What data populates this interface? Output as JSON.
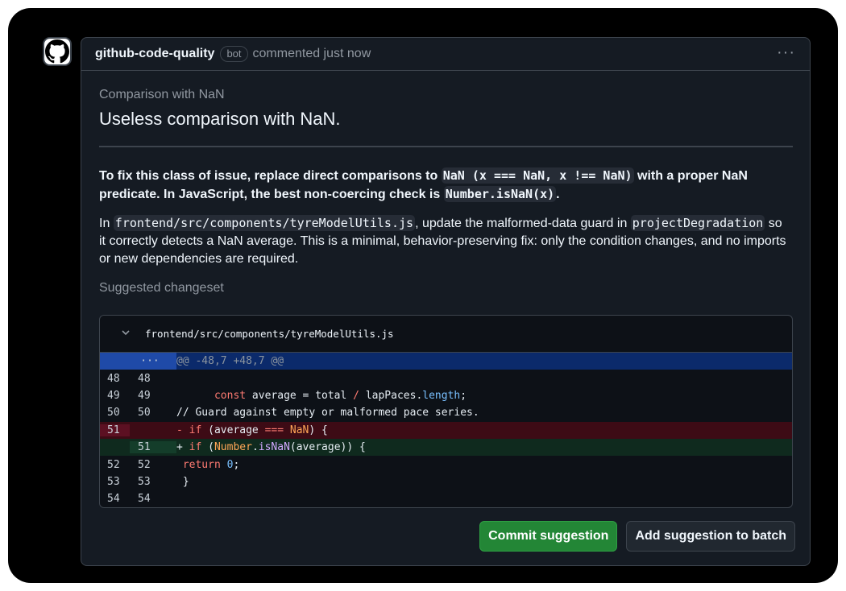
{
  "header": {
    "author": "github-code-quality",
    "badge": "bot",
    "meta": "commented just now",
    "menu_icon": "kebab-horizontal-icon"
  },
  "avatar": {
    "icon": "github-mark-icon"
  },
  "rule": {
    "id": "Comparison with NaN",
    "title": "Useless comparison with NaN."
  },
  "description": {
    "p1_a": "To fix this class of issue, replace direct comparisons to ",
    "p1_code1": "NaN (x === NaN, x !== NaN)",
    "p1_b": " with a proper NaN predicate. In JavaScript, the best non-coercing check is ",
    "p1_code2": "Number.isNaN(x)",
    "p1_c": ".",
    "p2_a": "In ",
    "p2_code1": "frontend/src/components/tyreModelUtils.js",
    "p2_b": ", update the malformed-data guard in ",
    "p2_code2": "projectDegradation",
    "p2_c": " so it correctly detects a NaN average. This is a minimal, behavior-preserving fix: only the condition changes, and no imports or new dependencies are required."
  },
  "changeset_label": "Suggested changeset",
  "diff": {
    "file_path": "frontend/src/components/tyreModelUtils.js",
    "expand_icon": "chevron-down-icon",
    "hunk_header": "@@ -48,7 +48,7 @@",
    "hunk_expander": "···",
    "lines": [
      {
        "old": "48",
        "new": "48",
        "type": "context"
      },
      {
        "old": "49",
        "new": "49",
        "type": "context"
      },
      {
        "old": "50",
        "new": "50",
        "type": "context",
        "text": "// Guard against empty or malformed pace series."
      },
      {
        "old": "51",
        "new": "",
        "type": "del"
      },
      {
        "old": "",
        "new": "51",
        "type": "add"
      },
      {
        "old": "52",
        "new": "52",
        "type": "context"
      },
      {
        "old": "53",
        "new": "53",
        "type": "context",
        "text": " }"
      },
      {
        "old": "54",
        "new": "54",
        "type": "context",
        "text": ""
      }
    ],
    "tokens": {
      "l49_kw": "const",
      "l49_a": " average = total ",
      "l49_op": "/",
      "l49_b": " lapPaces.",
      "l49_prop": "length",
      "l49_c": ";",
      "l51_prefix": "- ",
      "l51_kw": "if",
      "l51_a": " (average ",
      "l51_op": "===",
      "l51_b": " ",
      "l51_nan": "NaN",
      "l51_c": ") {",
      "l51n_prefix": "+ ",
      "l51n_kw": "if",
      "l51n_a": " (",
      "l51n_cls": "Number",
      "l51n_b": ".",
      "l51n_fn": "isNaN",
      "l51n_c": "(average)) {",
      "l52_kw": "return",
      "l52_sp": " ",
      "l52_num": "0",
      "l52_c": ";"
    }
  },
  "actions": {
    "commit": "Commit suggestion",
    "batch": "Add suggestion to batch"
  },
  "colors": {
    "commit_button": "#238636",
    "hunk_bg": "#0b2a6b",
    "deleted_bg": "#3d0b15",
    "added_bg": "#0f2a1e"
  }
}
